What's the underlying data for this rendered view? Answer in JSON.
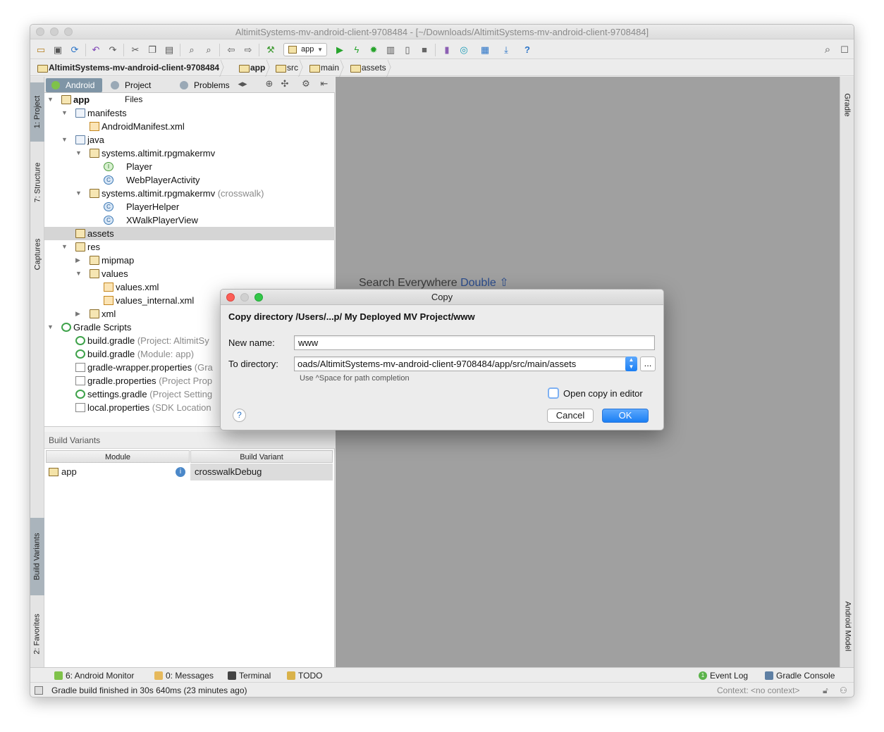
{
  "window": {
    "title": "AltimitSystems-mv-android-client-9708484 - [~/Downloads/AltimitSystems-mv-android-client-9708484]"
  },
  "toolbar": {
    "run_config": "app"
  },
  "breadcrumb": [
    "AltimitSystems-mv-android-client-9708484",
    "app",
    "src",
    "main",
    "assets"
  ],
  "left_strip": [
    "1: Project",
    "7: Structure",
    "Captures",
    "Build Variants",
    "2: Favorites"
  ],
  "right_strip": [
    "Gradle",
    "Android Model"
  ],
  "project_tabs": [
    "Android",
    "Project Files",
    "Problems"
  ],
  "tree": [
    {
      "label": "app",
      "extra": ""
    },
    {
      "label": "manifests",
      "extra": ""
    },
    {
      "label": "AndroidManifest.xml",
      "extra": ""
    },
    {
      "label": "java",
      "extra": ""
    },
    {
      "label": "systems.altimit.rpgmakermv",
      "extra": ""
    },
    {
      "label": "Player",
      "extra": ""
    },
    {
      "label": "WebPlayerActivity",
      "extra": ""
    },
    {
      "label": "systems.altimit.rpgmakermv",
      "extra": "(crosswalk)"
    },
    {
      "label": "PlayerHelper",
      "extra": ""
    },
    {
      "label": "XWalkPlayerView",
      "extra": ""
    },
    {
      "label": "assets",
      "extra": ""
    },
    {
      "label": "res",
      "extra": ""
    },
    {
      "label": "mipmap",
      "extra": ""
    },
    {
      "label": "values",
      "extra": ""
    },
    {
      "label": "values.xml",
      "extra": ""
    },
    {
      "label": "values_internal.xml",
      "extra": ""
    },
    {
      "label": "xml",
      "extra": ""
    },
    {
      "label": "Gradle Scripts",
      "extra": ""
    },
    {
      "label": "build.gradle",
      "extra": "(Project: AltimitSy"
    },
    {
      "label": "build.gradle",
      "extra": "(Module: app)"
    },
    {
      "label": "gradle-wrapper.properties",
      "extra": "(Gra"
    },
    {
      "label": "gradle.properties",
      "extra": "(Project Prop"
    },
    {
      "label": "settings.gradle",
      "extra": "(Project Setting"
    },
    {
      "label": "local.properties",
      "extra": "(SDK Location"
    }
  ],
  "build_variants": {
    "title": "Build Variants",
    "col_module": "Module",
    "col_variant": "Build Variant",
    "module": "app",
    "variant": "crosswalkDebug"
  },
  "editor": {
    "hint_text": "Search Everywhere",
    "hint_key": "Double"
  },
  "dialog": {
    "title": "Copy",
    "heading": "Copy directory /Users/...p/ My Deployed MV Project/www",
    "new_name_label": "New name:",
    "new_name_value": "www",
    "to_dir_label": "To directory:",
    "to_dir_value": "oads/AltimitSystems-mv-android-client-9708484/app/src/main/assets",
    "browse": "...",
    "path_hint": "Use ^Space for path completion",
    "open_copy": "Open copy in editor",
    "help": "?",
    "cancel": "Cancel",
    "ok": "OK"
  },
  "bottom_tools": [
    "6: Android Monitor",
    "0: Messages",
    "Terminal",
    "TODO"
  ],
  "bottom_tools_right": [
    "Event Log",
    "Gradle Console"
  ],
  "event_count": "1",
  "status": {
    "message": "Gradle build finished in 30s 640ms (23 minutes ago)",
    "context": "Context: <no context>"
  }
}
